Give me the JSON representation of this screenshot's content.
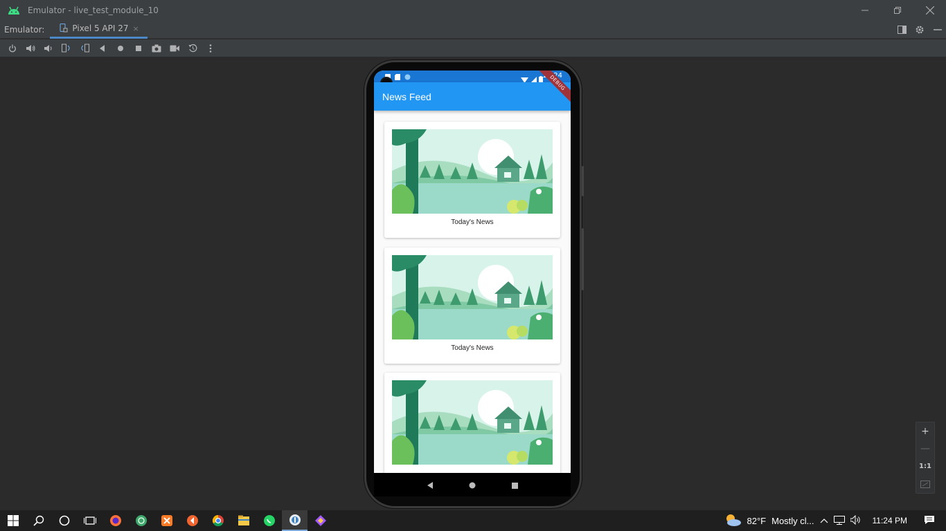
{
  "window": {
    "title": "Emulator - live_test_module_10",
    "icons": [
      "android-icon",
      "minimize-icon",
      "restore-icon",
      "close-icon"
    ]
  },
  "tabbar": {
    "label": "Emulator:",
    "tab_label": "Pixel 5 API 27",
    "tab_close": "×"
  },
  "toolbar": {
    "buttons": [
      "power-icon",
      "volume-up-icon",
      "volume-down-icon",
      "rotate-left-icon",
      "rotate-right-icon",
      "back-icon",
      "home-icon",
      "overview-icon",
      "screenshot-icon",
      "screenrecord-icon",
      "restore-snapshot-icon",
      "more-icon"
    ]
  },
  "device": {
    "status_time": "11:24",
    "debug_banner": "DEBUG",
    "app_title": "News Feed",
    "cards": [
      {
        "caption": "Today's News"
      },
      {
        "caption": "Today's News"
      },
      {
        "caption": ""
      }
    ]
  },
  "zoom": {
    "zoom_in": "+",
    "zoom_out": "—",
    "actual_size": "1:1"
  },
  "taskbar": {
    "weather_temp": "82°F",
    "weather_text": "Mostly cl...",
    "clock": "11:24 PM"
  },
  "colors": {
    "app_bar": "#2196f3",
    "status_bar": "#1976d2",
    "ide_bg": "#2b2b2b",
    "accent": "#4a88c7"
  }
}
